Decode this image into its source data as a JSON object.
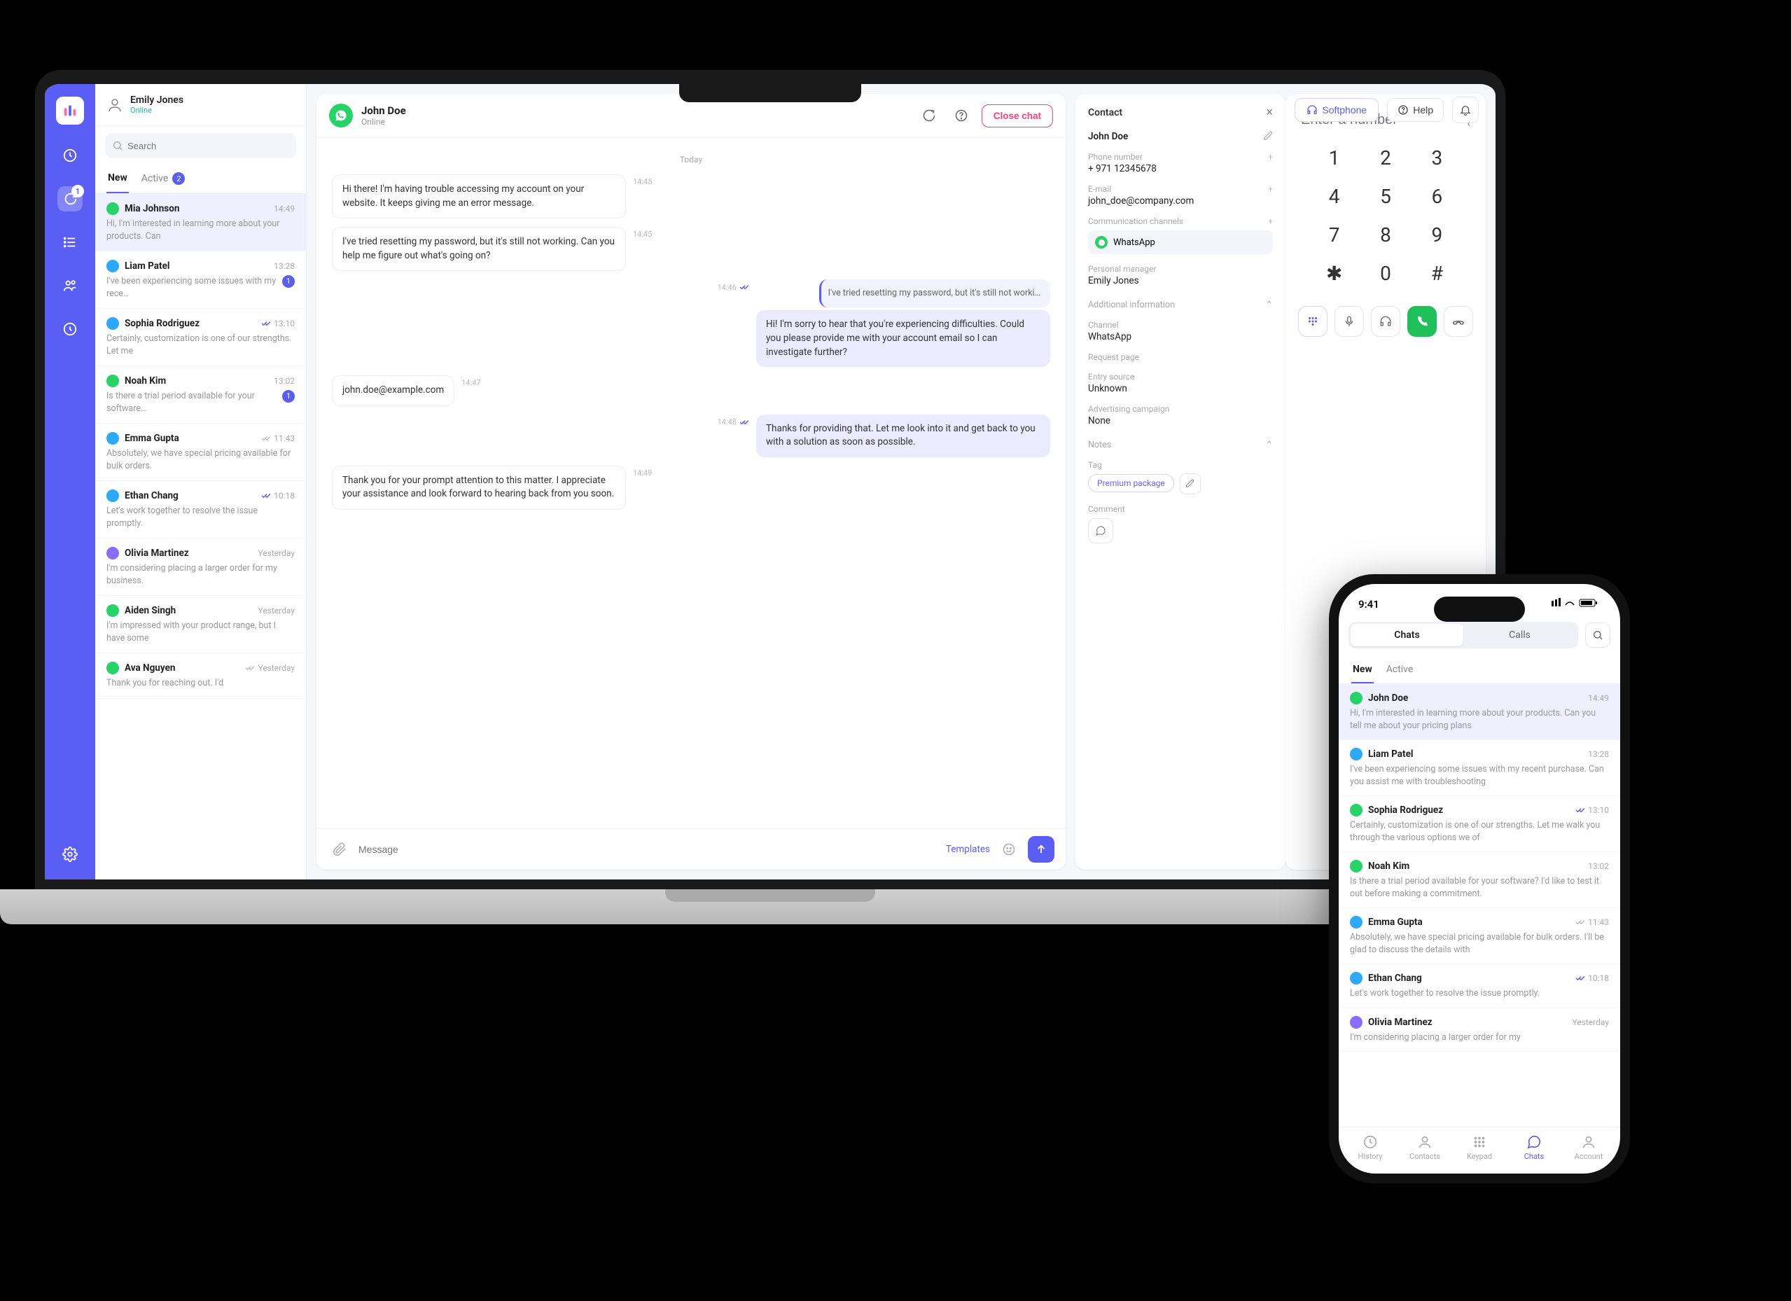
{
  "header": {
    "user_name": "Emily Jones",
    "user_status": "Online",
    "search_placeholder": "Search",
    "softphone_label": "Softphone",
    "help_label": "Help"
  },
  "chat_tabs": {
    "new": "New",
    "active": "Active",
    "active_count": "2"
  },
  "conversations": [
    {
      "name": "Mia Johnson",
      "time": "14:49",
      "preview": "Hi, I'm interested in learning more about your products. Can",
      "color": "#25d366",
      "selected": true
    },
    {
      "name": "Liam Patel",
      "time": "13:28",
      "preview": "I've been experiencing some issues with my rece…",
      "color": "#2aa9ff",
      "badge": "1"
    },
    {
      "name": "Sophia Rodriguez",
      "time": "13:10",
      "preview": "Certainly, customization is one of our strengths. Let me",
      "color": "#2aa9ff",
      "read": true
    },
    {
      "name": "Noah Kim",
      "time": "13:02",
      "preview": "Is there a trial period available for your software…",
      "color": "#25d366",
      "badge": "1"
    },
    {
      "name": "Emma Gupta",
      "time": "11:43",
      "preview": "Absolutely, we have special pricing available for bulk orders.",
      "color": "#2aa9ff",
      "read_grey": true
    },
    {
      "name": "Ethan Chang",
      "time": "10:18",
      "preview": "Let's work together to resolve the issue promptly.",
      "color": "#2aa9ff",
      "read": true
    },
    {
      "name": "Olivia Martinez",
      "time": "Yesterday",
      "preview": "I'm considering placing a larger order for my business.",
      "color": "#8a6dff"
    },
    {
      "name": "Aiden Singh",
      "time": "Yesterday",
      "preview": "I'm impressed with your product range, but I have some",
      "color": "#25d366"
    },
    {
      "name": "Ava Nguyen",
      "time": "Yesterday",
      "preview": "Thank you for reaching out. I'd",
      "color": "#25d366",
      "read_grey": true
    }
  ],
  "chat": {
    "contact_name": "John Doe",
    "contact_status": "Online",
    "close_label": "Close chat",
    "day_separator": "Today",
    "templates_label": "Templates",
    "input_placeholder": "Message",
    "messages": [
      {
        "dir": "in",
        "text": "Hi there! I'm having trouble accessing my account on your website. It keeps giving me an error message.",
        "time": "14:45"
      },
      {
        "dir": "in",
        "text": "I've tried resetting my password, but it's still not working. Can you help me figure out what's going on?",
        "time": "14:45"
      },
      {
        "dir": "out",
        "quote": "I've tried resetting my password, but it's still not worki…",
        "text": "Hi! I'm sorry to hear that you're experiencing difficulties. Could you please provide me with your account email so I can investigate further?",
        "time": "14:46",
        "read": true
      },
      {
        "dir": "in",
        "text": "john.doe@example.com",
        "time": "14:47"
      },
      {
        "dir": "out",
        "text": "Thanks for providing that. Let me look into it and get back to you with a solution as soon as possible.",
        "time": "14:48",
        "read": true
      },
      {
        "dir": "in",
        "text": "Thank you for your prompt attention to this matter. I appreciate your assistance and look forward to hearing back from you soon.",
        "time": "14:49"
      }
    ]
  },
  "contact_panel": {
    "title": "Contact",
    "name": "John Doe",
    "phone_label": "Phone number",
    "phone": "+ 971 12345678",
    "email_label": "E-mail",
    "email": "john_doe@company.com",
    "channels_label": "Communication channels",
    "channel": "WhatsApp",
    "manager_label": "Personal manager",
    "manager": "Emily Jones",
    "additional_label": "Additional information",
    "channel_field_label": "Channel",
    "channel_field": "WhatsApp",
    "request_page_label": "Request page",
    "entry_source_label": "Entry source",
    "entry_source": "Unknown",
    "campaign_label": "Advertising campaign",
    "campaign": "None",
    "notes_label": "Notes",
    "tag_label": "Tag",
    "tag_value": "Premium package",
    "comment_label": "Comment"
  },
  "dialer": {
    "placeholder": "Enter a number",
    "keys": [
      "1",
      "2",
      "3",
      "4",
      "5",
      "6",
      "7",
      "8",
      "9",
      "✱",
      "0",
      "#"
    ]
  },
  "phone": {
    "time": "9:41",
    "seg_chats": "Chats",
    "seg_calls": "Calls",
    "tab_new": "New",
    "tab_active": "Active",
    "nav": {
      "history": "History",
      "contacts": "Contacts",
      "keypad": "Keypad",
      "chats": "Chats",
      "account": "Account"
    },
    "conversations": [
      {
        "name": "John Doe",
        "time": "14:49",
        "preview": "Hi, I'm interested in learning more about your products. Can you tell me about your pricing plans",
        "color": "#25d366",
        "selected": true
      },
      {
        "name": "Liam Patel",
        "time": "13:28",
        "preview": "I've been experiencing some issues with my recent purchase. Can you assist me with troubleshooting",
        "color": "#2aa9ff"
      },
      {
        "name": "Sophia Rodriguez",
        "time": "13:10",
        "preview": "Certainly, customization is one of our strengths. Let me walk you through the various options we of",
        "color": "#25d366",
        "read": true
      },
      {
        "name": "Noah Kim",
        "time": "13:02",
        "preview": "Is there a trial period available for your software? I'd like to test it out before making a commitment.",
        "color": "#25d366"
      },
      {
        "name": "Emma Gupta",
        "time": "11:43",
        "preview": "Absolutely, we have special pricing available for bulk orders. I'll be glad to discuss the details with",
        "color": "#2aa9ff",
        "read_grey": true
      },
      {
        "name": "Ethan Chang",
        "time": "10:18",
        "preview": "Let's work together to resolve the issue promptly.",
        "color": "#2aa9ff",
        "read": true
      },
      {
        "name": "Olivia Martinez",
        "time": "Yesterday",
        "preview": "I'm considering placing a larger order for my",
        "color": "#8a6dff"
      }
    ]
  }
}
